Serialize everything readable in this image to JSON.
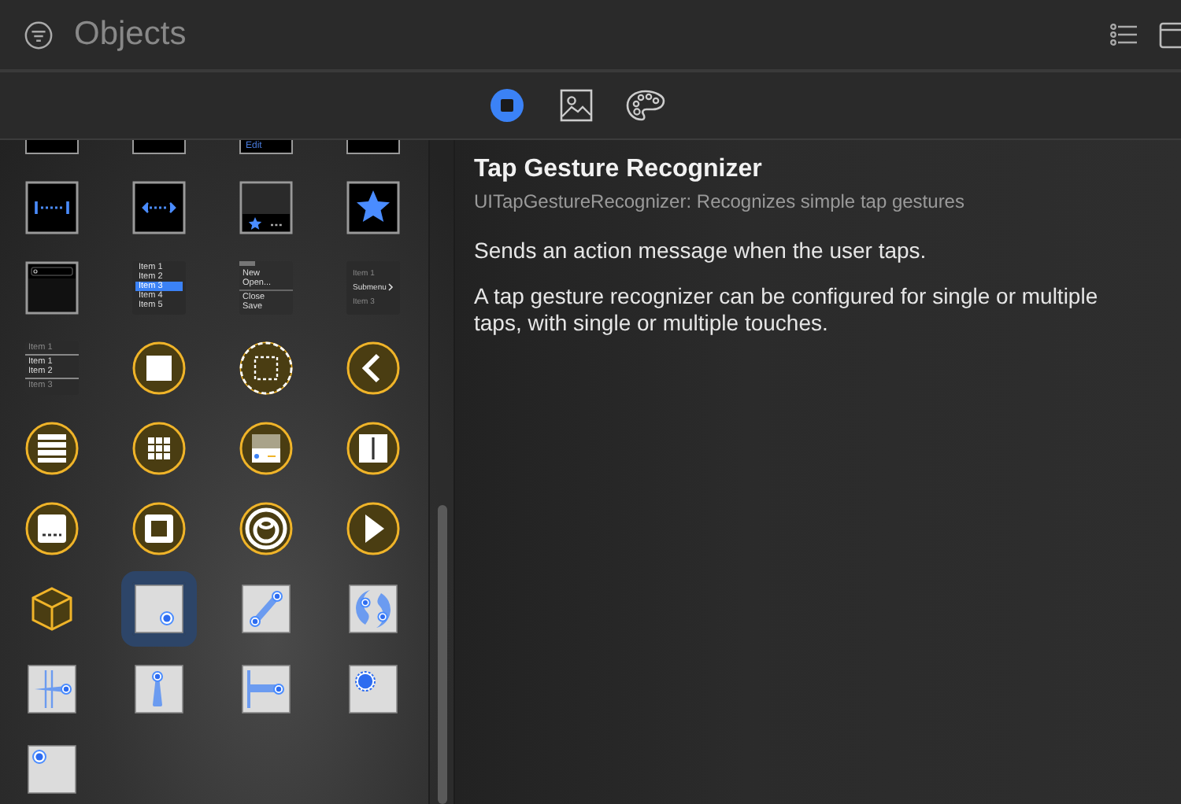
{
  "search": {
    "placeholder": "Objects"
  },
  "tabs": [
    {
      "kind": "objects",
      "selected": true
    },
    {
      "kind": "media",
      "selected": false
    },
    {
      "kind": "colors",
      "selected": false
    }
  ],
  "tiles": [
    {
      "kind": "dark-box",
      "selected": false
    },
    {
      "kind": "dark-box",
      "selected": false
    },
    {
      "kind": "dark-box",
      "selected": false,
      "lines": [
        "Edit"
      ]
    },
    {
      "kind": "dark-box",
      "selected": false
    },
    {
      "kind": "page-control",
      "selected": false
    },
    {
      "kind": "stepper",
      "selected": false
    },
    {
      "kind": "tab-bar",
      "selected": false
    },
    {
      "kind": "star",
      "selected": false
    },
    {
      "kind": "search-bar",
      "selected": false
    },
    {
      "kind": "list",
      "selected": false,
      "items": [
        {
          "text": "Item 1",
          "selected": false
        },
        {
          "text": "Item 2",
          "selected": false
        },
        {
          "text": "Item 3",
          "selected": true
        },
        {
          "text": "Item 4",
          "selected": false
        },
        {
          "text": "Item 5",
          "selected": false
        }
      ]
    },
    {
      "kind": "menu",
      "selected": false,
      "lines": [
        "New",
        "Open...",
        "Close",
        "Save"
      ]
    },
    {
      "kind": "submenu",
      "selected": false,
      "lines": [
        "Item 1",
        "Submenu",
        "Item 3"
      ]
    },
    {
      "kind": "table",
      "selected": false,
      "lines": [
        "Item 1",
        "Item 1",
        "Item 2",
        "Item 3"
      ]
    },
    {
      "kind": "circle-square",
      "selected": false
    },
    {
      "kind": "circle-dashed",
      "selected": false
    },
    {
      "kind": "circle-chevron",
      "selected": false
    },
    {
      "kind": "circle-lines",
      "selected": false
    },
    {
      "kind": "circle-grid",
      "selected": false
    },
    {
      "kind": "circle-window",
      "selected": false
    },
    {
      "kind": "circle-split",
      "selected": false
    },
    {
      "kind": "circle-dots",
      "selected": false
    },
    {
      "kind": "circle-frame",
      "selected": false
    },
    {
      "kind": "circle-rings",
      "selected": false
    },
    {
      "kind": "circle-play",
      "selected": false
    },
    {
      "kind": "cube",
      "selected": false
    },
    {
      "kind": "tap",
      "selected": true
    },
    {
      "kind": "pinch",
      "selected": false
    },
    {
      "kind": "rotation",
      "selected": false
    },
    {
      "kind": "swipe",
      "selected": false
    },
    {
      "kind": "pan",
      "selected": false
    },
    {
      "kind": "edge-pan",
      "selected": false
    },
    {
      "kind": "long-press",
      "selected": false
    },
    {
      "kind": "hover",
      "selected": false
    }
  ],
  "detail": {
    "title": "Tap Gesture Recognizer",
    "subtitle": "UITapGestureRecognizer: Recognizes simple tap gestures",
    "paragraphs": [
      "Sends an action message when the user taps.",
      "A tap gesture recognizer can be configured for single or multiple taps, with single or multiple touches."
    ]
  }
}
